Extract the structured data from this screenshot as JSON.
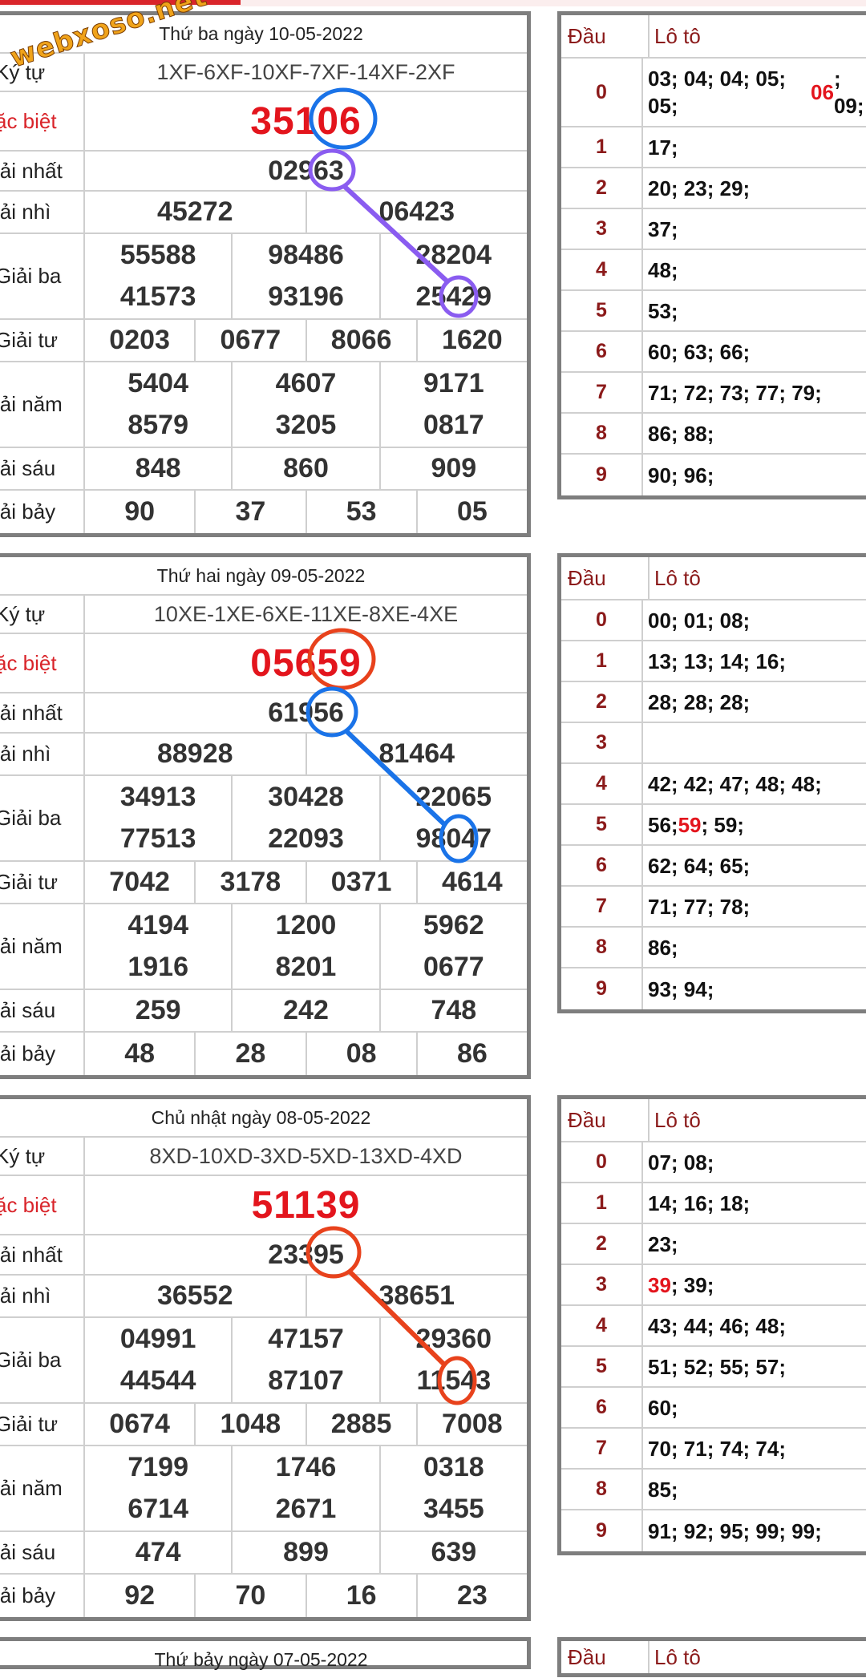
{
  "watermark": "webxoso.net",
  "draws": [
    {
      "title": "Thứ ba ngày 10-05-2022",
      "labels": {
        "kytu": "Ký tự",
        "db": "ặc biệt",
        "g1": "iải nhất",
        "g2": "iải nhì",
        "g3": "Giải ba",
        "g4": "Giải tư",
        "g5": "iải năm",
        "g6": "iải sáu",
        "g7": "iải bảy"
      },
      "kytu": "1XF-6XF-10XF-7XF-14XF-2XF",
      "db": "35106",
      "g1": "02963",
      "g2": [
        "45272",
        "06423"
      ],
      "g3": [
        "55588",
        "98486",
        "28204",
        "41573",
        "93196",
        "25429"
      ],
      "g4": [
        "0203",
        "0677",
        "8066",
        "1620"
      ],
      "g5": [
        "5404",
        "4607",
        "9171",
        "8579",
        "3205",
        "0817"
      ],
      "g6": [
        "848",
        "860",
        "909"
      ],
      "g7": [
        "90",
        "37",
        "53",
        "05"
      ],
      "loto_head": [
        "Đầu",
        "Lô tô"
      ],
      "loto": [
        {
          "d": "0",
          "v": "03; 04; 04; 05; 05; ",
          "hi": "06",
          "tail": "; 09;"
        },
        {
          "d": "1",
          "v": "17;"
        },
        {
          "d": "2",
          "v": "20; 23; 29;"
        },
        {
          "d": "3",
          "v": "37;"
        },
        {
          "d": "4",
          "v": "48;"
        },
        {
          "d": "5",
          "v": "53;"
        },
        {
          "d": "6",
          "v": "60; 63; 66;"
        },
        {
          "d": "7",
          "v": "71; 72; 73; 77; 79;"
        },
        {
          "d": "8",
          "v": "86; 88;"
        },
        {
          "d": "9",
          "v": "90; 96;"
        }
      ]
    },
    {
      "title": "Thứ hai ngày 09-05-2022",
      "labels": {
        "kytu": "Ký tự",
        "db": "ặc biệt",
        "g1": "iải nhất",
        "g2": "iải nhì",
        "g3": "Giải ba",
        "g4": "Giải tư",
        "g5": "iải năm",
        "g6": "iải sáu",
        "g7": "iải bảy"
      },
      "kytu": "10XE-1XE-6XE-11XE-8XE-4XE",
      "db": "05659",
      "g1": "61956",
      "g2": [
        "88928",
        "81464"
      ],
      "g3": [
        "34913",
        "30428",
        "22065",
        "77513",
        "22093",
        "98047"
      ],
      "g4": [
        "7042",
        "3178",
        "0371",
        "4614"
      ],
      "g5": [
        "4194",
        "1200",
        "5962",
        "1916",
        "8201",
        "0677"
      ],
      "g6": [
        "259",
        "242",
        "748"
      ],
      "g7": [
        "48",
        "28",
        "08",
        "86"
      ],
      "loto_head": [
        "Đầu",
        "Lô tô"
      ],
      "loto": [
        {
          "d": "0",
          "v": "00; 01; 08;"
        },
        {
          "d": "1",
          "v": "13; 13; 14; 16;"
        },
        {
          "d": "2",
          "v": "28; 28; 28;"
        },
        {
          "d": "3",
          "v": ""
        },
        {
          "d": "4",
          "v": "42; 42; 47; 48; 48;"
        },
        {
          "d": "5",
          "v": "56; ",
          "hi": "59",
          "tail": "; 59;"
        },
        {
          "d": "6",
          "v": "62; 64; 65;"
        },
        {
          "d": "7",
          "v": "71; 77; 78;"
        },
        {
          "d": "8",
          "v": "86;"
        },
        {
          "d": "9",
          "v": "93; 94;"
        }
      ]
    },
    {
      "title": "Chủ nhật ngày 08-05-2022",
      "labels": {
        "kytu": "Ký tự",
        "db": "ặc biệt",
        "g1": "iải nhất",
        "g2": "iải nhì",
        "g3": "Giải ba",
        "g4": "Giải tư",
        "g5": "iải năm",
        "g6": "iải sáu",
        "g7": "iải bảy"
      },
      "kytu": "8XD-10XD-3XD-5XD-13XD-4XD",
      "db": "51139",
      "g1": "23395",
      "g2": [
        "36552",
        "38651"
      ],
      "g3": [
        "04991",
        "47157",
        "29360",
        "44544",
        "87107",
        "11543"
      ],
      "g4": [
        "0674",
        "1048",
        "2885",
        "7008"
      ],
      "g5": [
        "7199",
        "1746",
        "0318",
        "6714",
        "2671",
        "3455"
      ],
      "g6": [
        "474",
        "899",
        "639"
      ],
      "g7": [
        "92",
        "70",
        "16",
        "23"
      ],
      "loto_head": [
        "Đầu",
        "Lô tô"
      ],
      "loto": [
        {
          "d": "0",
          "v": "07; 08;"
        },
        {
          "d": "1",
          "v": "14; 16; 18;"
        },
        {
          "d": "2",
          "v": "23;"
        },
        {
          "d": "3",
          "v": "",
          "hi": "39",
          "tail": "; 39;"
        },
        {
          "d": "4",
          "v": "43; 44; 46; 48;"
        },
        {
          "d": "5",
          "v": "51; 52; 55; 57;"
        },
        {
          "d": "6",
          "v": "60;"
        },
        {
          "d": "7",
          "v": "70; 71; 74; 74;"
        },
        {
          "d": "8",
          "v": "85;"
        },
        {
          "d": "9",
          "v": "91; 92; 95; 99; 99;"
        }
      ]
    }
  ],
  "next_block": {
    "title": "Thứ bảy ngày 07-05-2022",
    "loto_head": [
      "Đầu",
      "Lô tô"
    ]
  },
  "colors": {
    "red": "#e3151d",
    "blue": "#1a73e8",
    "purple": "#8a5cf0",
    "orange_red": "#e8421c"
  }
}
